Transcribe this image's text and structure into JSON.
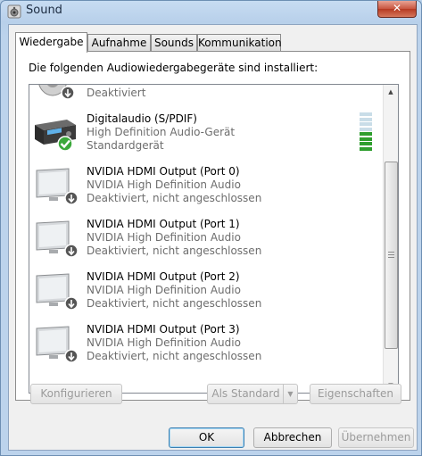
{
  "window": {
    "title": "Sound",
    "close_label": "✕"
  },
  "tabs": [
    {
      "label": "Wiedergabe",
      "active": true
    },
    {
      "label": "Aufnahme",
      "active": false
    },
    {
      "label": "Sounds",
      "active": false
    },
    {
      "label": "Kommunikation",
      "active": false
    }
  ],
  "panel": {
    "label": "Die folgenden Audiowiedergabegeräte sind installiert:"
  },
  "devices": [
    {
      "name": "",
      "description": "",
      "status": "Deaktiviert",
      "icon": "speaker-icon",
      "badge": "down-arrow-icon"
    },
    {
      "name": "Digitalaudio (S/PDIF)",
      "description": "High Definition Audio-Gerät",
      "status": "Standardgerät",
      "icon": "digital-audio-receiver-icon",
      "badge": "green-check-icon",
      "level": 0.5
    },
    {
      "name": "NVIDIA HDMI Output (Port 0)",
      "description": "NVIDIA High Definition Audio",
      "status": "Deaktiviert, nicht angeschlossen",
      "icon": "monitor-icon",
      "badge": "down-arrow-icon"
    },
    {
      "name": "NVIDIA HDMI Output (Port 1)",
      "description": "NVIDIA High Definition Audio",
      "status": "Deaktiviert, nicht angeschlossen",
      "icon": "monitor-icon",
      "badge": "down-arrow-icon"
    },
    {
      "name": "NVIDIA HDMI Output (Port 2)",
      "description": "NVIDIA High Definition Audio",
      "status": "Deaktiviert, nicht angeschlossen",
      "icon": "monitor-icon",
      "badge": "down-arrow-icon"
    },
    {
      "name": "NVIDIA HDMI Output (Port 3)",
      "description": "NVIDIA High Definition Audio",
      "status": "Deaktiviert, nicht angeschlossen",
      "icon": "monitor-icon",
      "badge": "down-arrow-icon"
    }
  ],
  "buttons": {
    "configure": "Konfigurieren",
    "set_default": "Als Standard",
    "properties": "Eigenschaften",
    "ok": "OK",
    "cancel": "Abbrechen",
    "apply": "Übernehmen"
  },
  "colors": {
    "level_on": "#2e9e2e",
    "level_off": "#c9dde8",
    "check": "#3aa83a",
    "titlebar": "#c7dcf2"
  }
}
